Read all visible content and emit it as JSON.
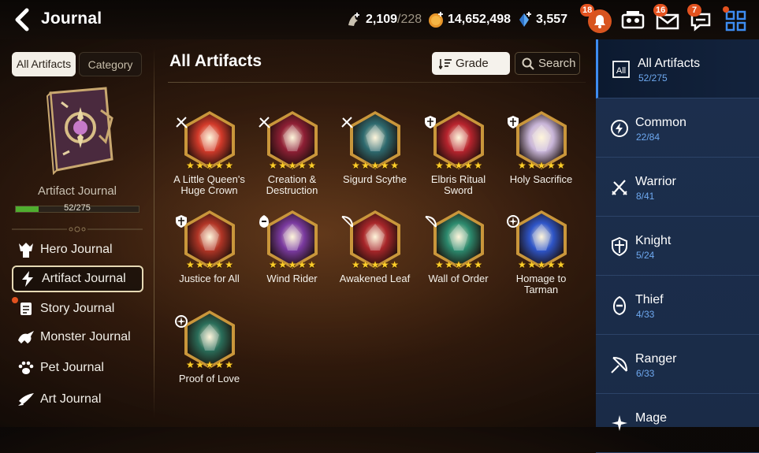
{
  "header": {
    "title": "Journal",
    "resources": [
      {
        "name": "stamina",
        "value": "2,109",
        "max": "/228"
      },
      {
        "name": "gold",
        "value": "14,652,498"
      },
      {
        "name": "crystals",
        "value": "3,557"
      }
    ],
    "badges": {
      "notifications": "18",
      "mail": "16",
      "chat": "7"
    }
  },
  "left": {
    "tabs": [
      "All Artifacts",
      "Category"
    ],
    "journal_label": "Artifact Journal",
    "progress_text": "52/275",
    "progress_fraction": 0.189,
    "nav": [
      {
        "label": "Hero Journal",
        "icon": "hero-icon"
      },
      {
        "label": "Artifact Journal",
        "icon": "lightning-icon"
      },
      {
        "label": "Story Journal",
        "icon": "scroll-icon"
      },
      {
        "label": "Monster Journal",
        "icon": "dragon-icon"
      },
      {
        "label": "Pet Journal",
        "icon": "paw-icon"
      },
      {
        "label": "Art Journal",
        "icon": "brush-icon"
      }
    ]
  },
  "main": {
    "title": "All Artifacts",
    "grade_label": "Grade",
    "search_label": "Search",
    "artifacts": [
      {
        "name": "A Little Queen's Huge Crown",
        "class": "warrior",
        "rarity": 5,
        "color": "#d23a2a"
      },
      {
        "name": "Creation & Destruction",
        "class": "warrior",
        "rarity": 5,
        "color": "#8e1f35"
      },
      {
        "name": "Sigurd Scythe",
        "class": "warrior",
        "rarity": 5,
        "color": "#2e6a6f"
      },
      {
        "name": "Elbris Ritual Sword",
        "class": "knight",
        "rarity": 5,
        "color": "#b8242e"
      },
      {
        "name": "Holy Sacrifice",
        "class": "knight",
        "rarity": 5,
        "color": "#c9b6d9"
      },
      {
        "name": "Justice for All",
        "class": "knight",
        "rarity": 5,
        "color": "#b13526"
      },
      {
        "name": "Wind Rider",
        "class": "thief",
        "rarity": 5,
        "color": "#7a3aa0"
      },
      {
        "name": "Awakened Leaf",
        "class": "ranger",
        "rarity": 5,
        "color": "#a8262a"
      },
      {
        "name": "Wall of Order",
        "class": "ranger",
        "rarity": 5,
        "color": "#2c8a6e"
      },
      {
        "name": "Homage to Tarman",
        "class": "mage",
        "rarity": 5,
        "color": "#2e55c8"
      },
      {
        "name": "Proof of Love",
        "class": "mage",
        "rarity": 5,
        "color": "#2a6e5a"
      }
    ]
  },
  "right": {
    "categories": [
      {
        "name": "All Artifacts",
        "count": "52/275",
        "icon": "all-icon"
      },
      {
        "name": "Common",
        "count": "22/84",
        "icon": "common-icon"
      },
      {
        "name": "Warrior",
        "count": "8/41",
        "icon": "warrior-icon"
      },
      {
        "name": "Knight",
        "count": "5/24",
        "icon": "knight-icon"
      },
      {
        "name": "Thief",
        "count": "4/33",
        "icon": "thief-icon"
      },
      {
        "name": "Ranger",
        "count": "6/33",
        "icon": "ranger-icon"
      },
      {
        "name": "Mage",
        "count": "",
        "icon": "mage-icon"
      }
    ]
  },
  "colors": {
    "accent": "#3d8cf0",
    "badge": "#e2521f",
    "progress": "#4fae2f",
    "card_frame": "#c9963b"
  }
}
